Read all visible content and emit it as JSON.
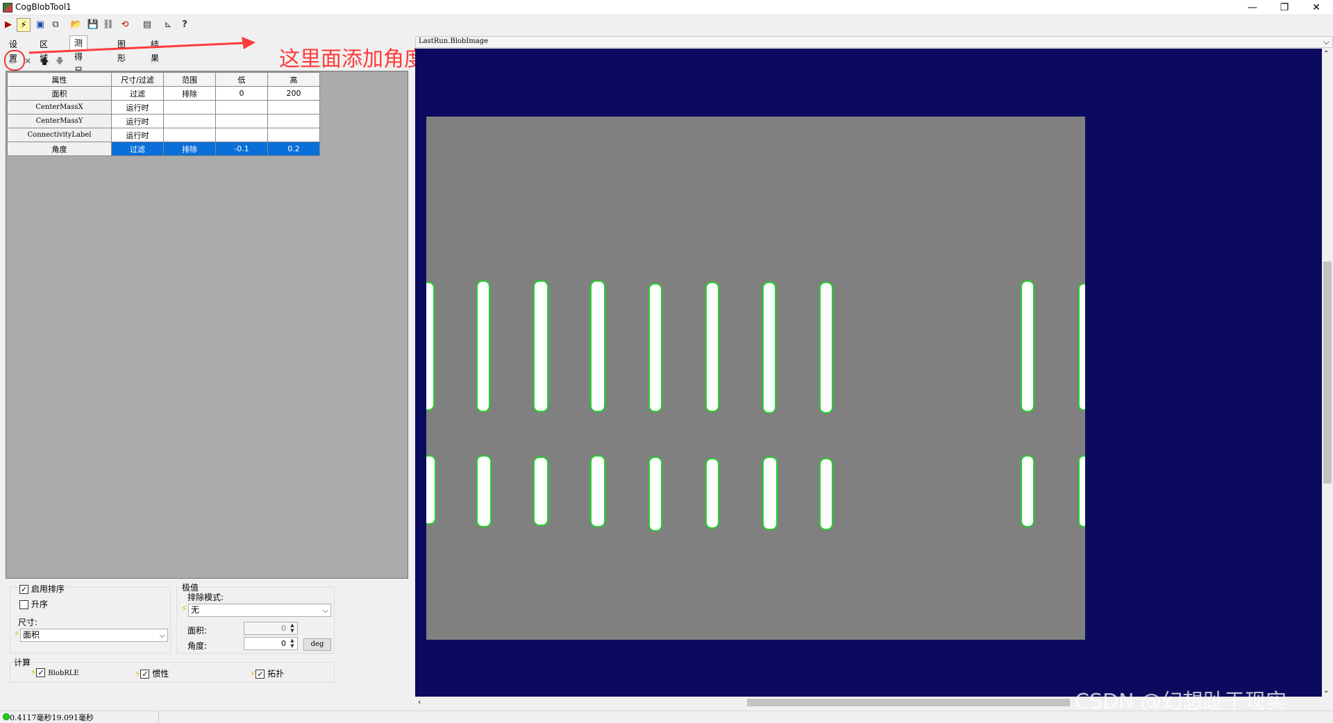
{
  "window": {
    "title": "CogBlobTool1",
    "btn_min": "—",
    "btn_restore": "❐",
    "btn_close": "✕"
  },
  "toolbar": {
    "icons": [
      "run-icon",
      "electric-icon",
      "image-icon",
      "copy-icon",
      "open-icon",
      "save-icon",
      "link-icon",
      "reset-icon",
      "display-icon",
      "chart-icon",
      "help-icon"
    ]
  },
  "tabs": [
    "设置",
    "区域",
    "测得尺寸",
    "图形",
    "结果"
  ],
  "active_tab": "测得尺寸",
  "annotation": {
    "text": "这里面添加角度",
    "color": "#ff3a3a"
  },
  "grid": {
    "headers": [
      "属性",
      "尺寸/过滤",
      "范围",
      "低",
      "高"
    ],
    "rows": [
      {
        "prop": "面积",
        "mode": "过滤",
        "range": "排除",
        "low": "0",
        "high": "200"
      },
      {
        "prop": "CenterMassX",
        "mode": "运行时",
        "range": "",
        "low": "",
        "high": ""
      },
      {
        "prop": "CenterMassY",
        "mode": "运行时",
        "range": "",
        "low": "",
        "high": ""
      },
      {
        "prop": "ConnectivityLabel",
        "mode": "运行时",
        "range": "",
        "low": "",
        "high": ""
      },
      {
        "prop": "角度",
        "mode": "过滤",
        "range": "排除",
        "low": "-0.1",
        "high": "0.2"
      }
    ],
    "selected_row": 4,
    "selection_color": "#0a6fd8"
  },
  "sort": {
    "enable_label": "启用排序",
    "enable_checked": true,
    "asc_label": "升序",
    "asc_checked": false,
    "size_label": "尺寸:",
    "size_value": "面积"
  },
  "extremes": {
    "group_label": "极值",
    "exclude_mode_label": "排除模式:",
    "exclude_mode_value": "无",
    "area_label": "面积:",
    "area_value": "0",
    "angle_label": "角度:",
    "angle_value": "0",
    "deg_button": "deg"
  },
  "compute": {
    "group_label": "计算",
    "items": [
      {
        "label": "BlobRLE",
        "checked": true
      },
      {
        "label": "惯性",
        "checked": true
      },
      {
        "label": "拓扑",
        "checked": true
      }
    ]
  },
  "status": {
    "text": "0.4117毫秒19.091毫秒"
  },
  "display": {
    "header": "LastRun.BlobImage",
    "background": "#0b0a5e",
    "image_background": "#808080",
    "blob_outline_color": "#22d32a"
  },
  "watermark": "CSDN @幻想趾于现实"
}
